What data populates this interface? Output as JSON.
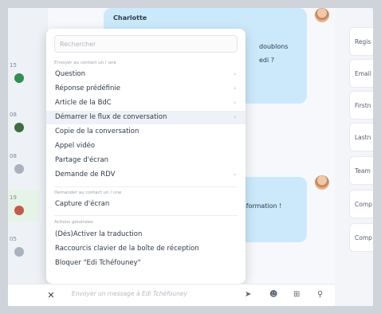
{
  "sidebar": {
    "items": [
      {
        "label": "15"
      },
      {
        "label": "08"
      },
      {
        "label": "08"
      },
      {
        "label": "19"
      },
      {
        "label": "05"
      }
    ]
  },
  "conversation": {
    "sender": "Charlotte",
    "bubble1_fragments": [
      "doublons",
      "edi ?"
    ],
    "bubble2_fragment": "e information !"
  },
  "popup": {
    "search_placeholder": "Rechercher",
    "section_send": "Envoyer au contact un / une",
    "send_items": [
      {
        "label": "Question",
        "has_submenu": true
      },
      {
        "label": "Réponse prédéfinie",
        "has_submenu": true
      },
      {
        "label": "Article de la BdC",
        "has_submenu": true
      },
      {
        "label": "Démarrer le flux de conversation",
        "has_submenu": true
      },
      {
        "label": "Copie de la conversation",
        "has_submenu": false
      },
      {
        "label": "Appel vidéo",
        "has_submenu": false
      },
      {
        "label": "Partage d'écran",
        "has_submenu": false
      },
      {
        "label": "Demande de RDV",
        "has_submenu": true
      }
    ],
    "section_ask": "Demander au contact un / une",
    "ask_items": [
      {
        "label": "Capture d'écran"
      }
    ],
    "section_actions": "Actions générales",
    "action_items": [
      {
        "label": "(Dés)Activer la traduction"
      },
      {
        "label": "Raccourcis clavier de la boîte de réception"
      },
      {
        "label": "Bloquer \"Edi Tchéfouney\""
      }
    ],
    "submenu_chevron": "›"
  },
  "composer": {
    "close_glyph": "✕",
    "placeholder": "Envoyer un message à Edi Tchéfouney",
    "icons": [
      "send-icon",
      "emoji-icon",
      "gift-icon",
      "attachment-icon"
    ]
  },
  "right_panel": {
    "fields": [
      "Regis",
      "Email",
      "Firstn",
      "Lastn",
      "Team",
      "Comp",
      "Comp"
    ]
  },
  "colors": {
    "bubble": "#cbe9fb",
    "active_item_bg": "#eef1f6",
    "sidebar_highlight": "#e6f4e8"
  }
}
